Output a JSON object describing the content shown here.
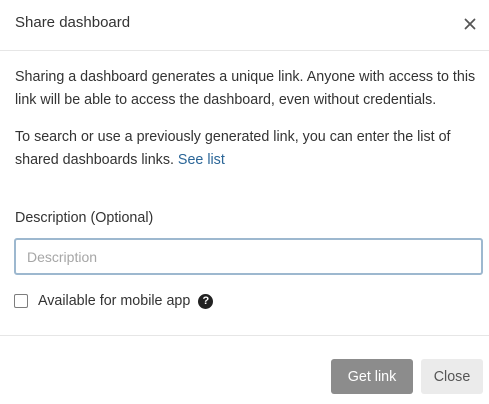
{
  "dialog": {
    "title": "Share dashboard",
    "close_icon": "close-icon"
  },
  "body": {
    "paragraph1": "Sharing a dashboard generates a unique link. Anyone with access to this link will be able to access the dashboard, even without credentials.",
    "paragraph2_text": "To search or use a previously generated link, you can enter the list of shared dashboards links. ",
    "see_list_link": "See list"
  },
  "form": {
    "description_label": "Description (Optional)",
    "description_value": "",
    "description_placeholder": "Description",
    "mobile_checkbox_label": "Available for mobile app",
    "mobile_checkbox_checked": false,
    "help_icon": "question-circle-icon",
    "help_glyph": "?"
  },
  "footer": {
    "get_link_label": "Get link",
    "close_label": "Close"
  }
}
